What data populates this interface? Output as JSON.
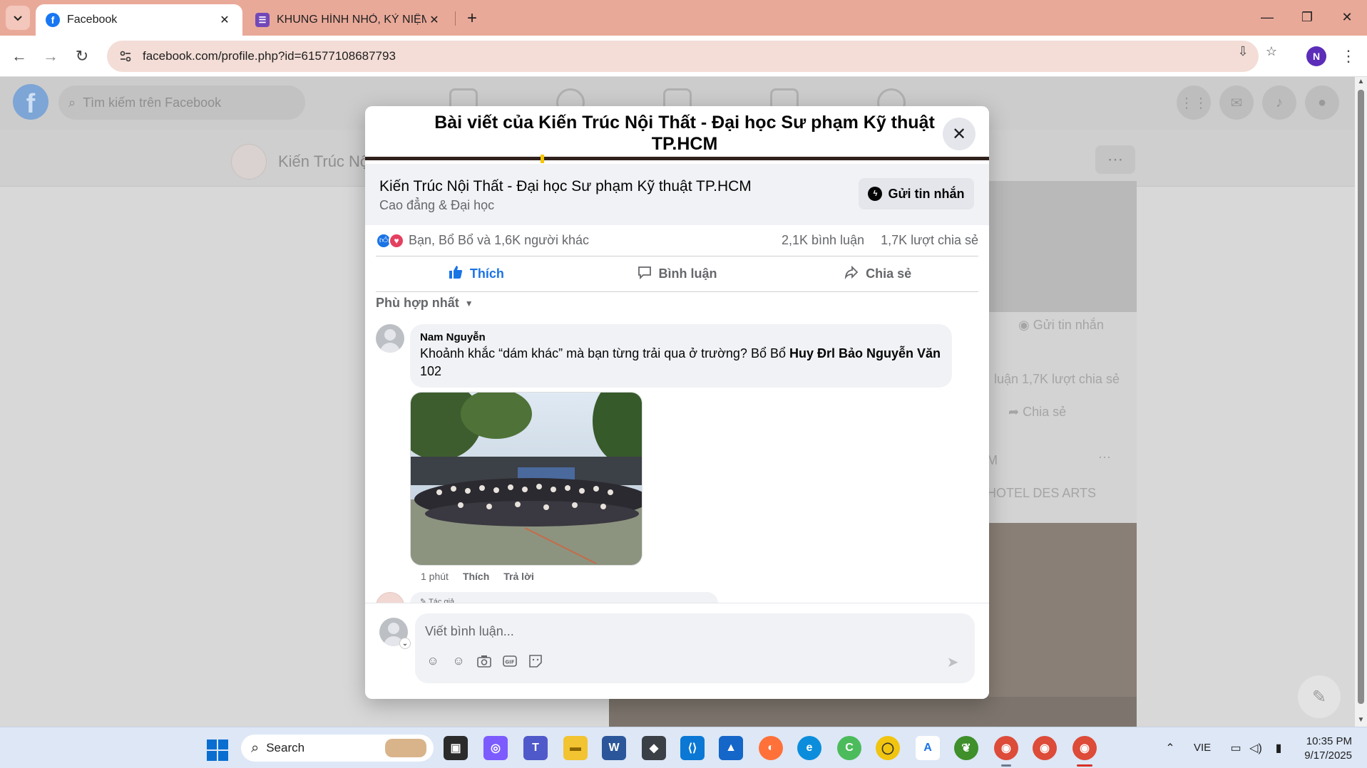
{
  "browser": {
    "tabs": [
      {
        "title": "Facebook",
        "active": true
      },
      {
        "title": "KHUNG HÌNH NHỎ, KỶ NIỆM TO",
        "active": false
      }
    ],
    "url": "facebook.com/profile.php?id=61577108687793",
    "profile_initial": "N",
    "icons": {
      "tab_list": "chevron-down-icon",
      "new_tab": "plus-icon",
      "back": "back-arrow-icon",
      "forward": "forward-arrow-icon",
      "reload": "reload-icon",
      "site_info": "site-info-icon",
      "install": "install-app-icon",
      "bookmark": "star-icon",
      "menu": "kebab-menu-icon"
    }
  },
  "background_page": {
    "search_placeholder": "Tìm kiếm trên Facebook",
    "page_name": "Kiến Trúc Nộ",
    "send_message": "Gửi tin nhắn",
    "stats_fragment": "luận   1,7K lượt chia sẻ",
    "share": "Chia sẻ",
    "post_fragment_letter": "M",
    "hotel_text": "HOTEL DES ARTS"
  },
  "modal": {
    "title": "Bài viết của Kiến Trúc Nội Thất - Đại học Sư phạm Kỹ thuật TP.HCM",
    "page_name": "Kiến Trúc Nội Thất - Đại học Sư phạm Kỹ thuật TP.HCM",
    "page_category": "Cao đẳng & Đại học",
    "message_button": "Gửi tin nhắn",
    "reactions_text": "Bạn, Bổ Bổ và 1,6K người khác",
    "comments_count": "2,1K bình luận",
    "shares_count": "1,7K lượt chia sẻ",
    "actions": {
      "like": "Thích",
      "comment": "Bình luận",
      "share": "Chia sẻ"
    },
    "sort_label": "Phù hợp nhất",
    "comment": {
      "author": "Nam Nguyễn",
      "text_before": "Khoảnh khắc “dám khác” mà bạn từng trải qua ở trường? Bổ Bổ ",
      "mention": "Huy Đrl Bảo Nguyễn Văn",
      "text_after": " 102",
      "time": "1 phút",
      "like": "Thích",
      "reply": "Trả lời"
    },
    "next_comment_badge": "Tác giả",
    "composer_placeholder": "Viết bình luận...",
    "composer_tools": [
      "avatar-sticker-icon",
      "emoji-icon",
      "camera-icon",
      "gif-icon",
      "sticker-icon"
    ]
  },
  "taskbar": {
    "search_label": "Search",
    "language": "VIE",
    "time": "10:35 PM",
    "date": "9/17/2025"
  },
  "colors": {
    "tabbar": "#e9a999",
    "fb_blue": "#1b74e4",
    "love_red": "#e4405f"
  }
}
